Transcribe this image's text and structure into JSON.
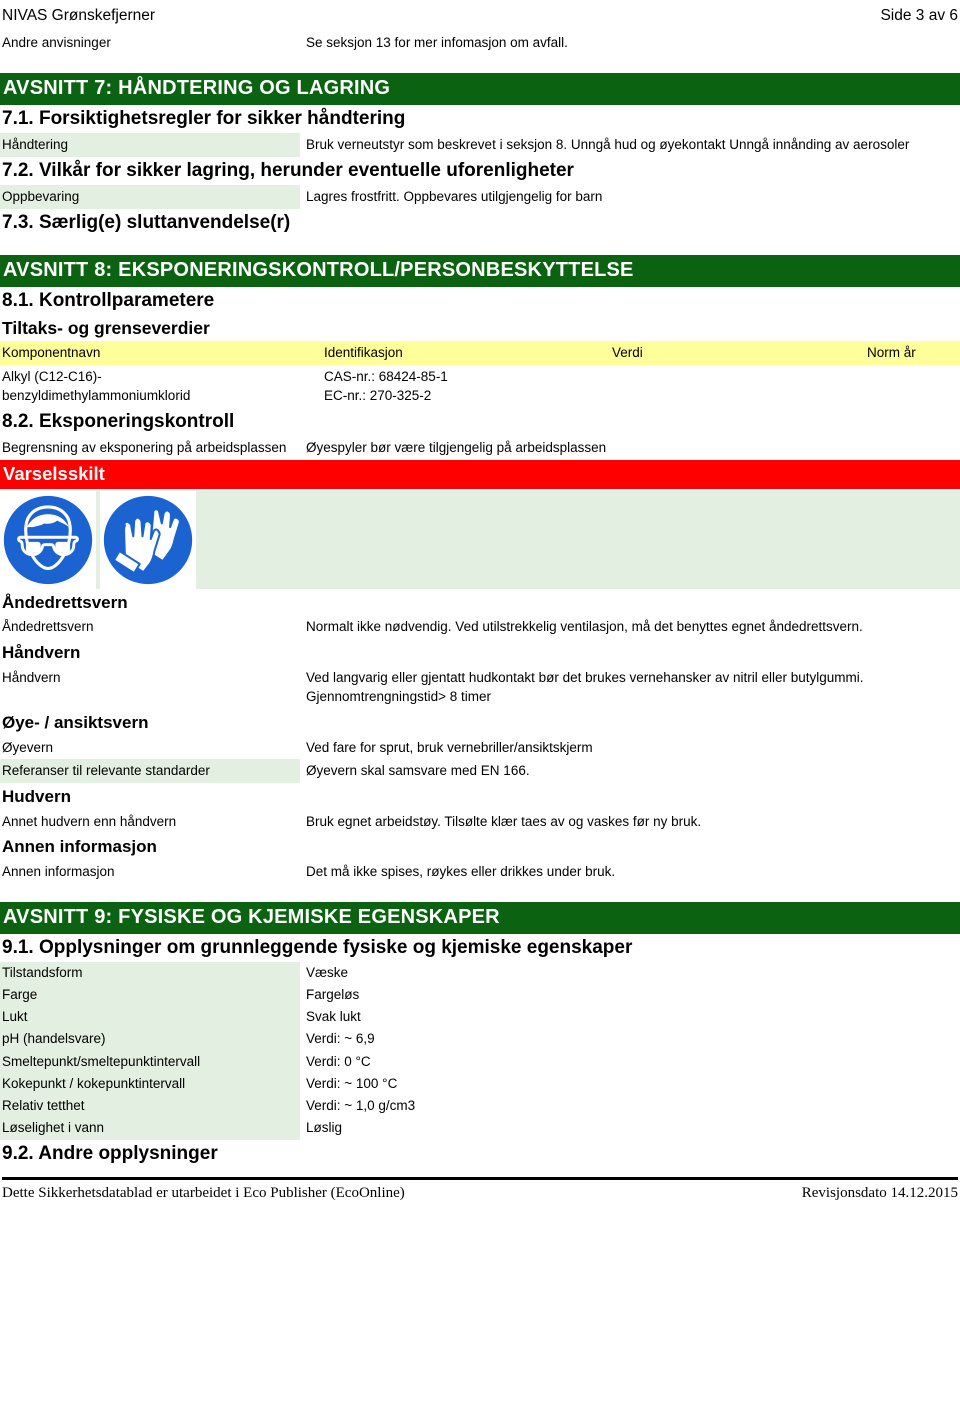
{
  "header": {
    "doc_title": "NIVAS Grønskefjerner",
    "page_label": "Side 3 av 6"
  },
  "top_row": {
    "label": "Andre anvisninger",
    "value": "Se seksjon 13 for mer infomasjon om avfall."
  },
  "section7": {
    "banner": "AVSNITT 7: HÅNDTERING OG LAGRING",
    "h71": "7.1. Forsiktighetsregler for sikker håndtering",
    "handtering_label": "Håndtering",
    "handtering_value": "Bruk verneutstyr som beskrevet i seksjon 8. Unngå hud og øyekontakt Unngå innånding av aerosoler",
    "h72": "7.2. Vilkår for sikker lagring, herunder eventuelle uforenligheter",
    "oppbevaring_label": "Oppbevaring",
    "oppbevaring_value": "Lagres frostfritt. Oppbevares utilgjengelig for barn",
    "h73": "7.3. Særlig(e) sluttanvendelse(r)"
  },
  "section8": {
    "banner": "AVSNITT 8: EKSPONERINGSKONTROLL/PERSONBESKYTTELSE",
    "h81": "8.1. Kontrollparametere",
    "limits_title": "Tiltaks- og grenseverdier",
    "limits_headers": [
      "Komponentnavn",
      "Identifikasjon",
      "Verdi",
      "Norm år"
    ],
    "limits_rows": [
      {
        "komponentnavn": "Alkyl (C12-C16)-benzyldimethylammoniumklorid",
        "komponentnavn_line1": "Alkyl (C12-C16)-",
        "komponentnavn_line2": "benzyldimethylammoniumklorid",
        "identifikasjon_line1": "CAS-nr.: 68424-85-1",
        "identifikasjon_line2": "EC-nr.: 270-325-2",
        "verdi": "",
        "norm_ar": ""
      }
    ],
    "h82": "8.2. Eksponeringskontroll",
    "begrensning_label": "Begrensning av eksponering på arbeidsplassen",
    "begrensning_value": "Øyespyler bør være tilgjengelig på arbeidsplassen",
    "varselsskilt": "Varselsskilt",
    "pictograms": [
      {
        "name": "eye-protection-pictogram",
        "alt": "Bruk vernebriller"
      },
      {
        "name": "hand-protection-pictogram",
        "alt": "Bruk vernehansker"
      }
    ],
    "protection_groups": [
      {
        "heading": "Åndedrettsvern",
        "label": "Åndedrettsvern",
        "value": "Normalt ikke nødvendig. Ved utilstrekkelig ventilasjon, må det benyttes egnet åndedrettsvern."
      },
      {
        "heading": "Håndvern",
        "label": "Håndvern",
        "value": "Ved langvarig eller gjentatt hudkontakt bør det brukes vernehansker av nitril eller butylgummi. Gjennomtrengningstid> 8 timer"
      },
      {
        "heading": "Øye- / ansiktsvern",
        "label": "Øyevern",
        "value": "Ved fare for sprut, bruk vernebriller/ansiktskjerm",
        "label2": "Referanser til relevante standarder",
        "value2": "Øyevern skal samsvare med EN 166."
      },
      {
        "heading": "Hudvern",
        "label": "Annet hudvern enn håndvern",
        "value": "Bruk egnet arbeidstøy. Tilsølte klær taes av og vaskes før ny bruk."
      },
      {
        "heading": "Annen informasjon",
        "label": "Annen informasjon",
        "value": "Det må ikke spises, røykes eller drikkes under bruk."
      }
    ]
  },
  "section9": {
    "banner": "AVSNITT 9: FYSISKE OG KJEMISKE EGENSKAPER",
    "h91": "9.1. Opplysninger om grunnleggende fysiske og kjemiske egenskaper",
    "properties": [
      {
        "label": "Tilstandsform",
        "value": "Væske"
      },
      {
        "label": "Farge",
        "value": "Fargeløs"
      },
      {
        "label": "Lukt",
        "value": "Svak lukt"
      },
      {
        "label": "pH (handelsvare)",
        "value": "Verdi: ~ 6,9"
      },
      {
        "label": "Smeltepunkt/smeltepunktintervall",
        "value": "Verdi: 0 °C"
      },
      {
        "label": "Kokepunkt / kokepunktintervall",
        "value": "Verdi: ~ 100 °C"
      },
      {
        "label": "Relativ tetthet",
        "value": "Verdi: ~ 1,0 g/cm3"
      },
      {
        "label": "Løselighet i vann",
        "value": "Løslig"
      }
    ],
    "h92": "9.2. Andre opplysninger"
  },
  "footer": {
    "left": "Dette Sikkerhetsdatablad er utarbeidet i Eco Publisher (EcoOnline)",
    "right": "Revisjonsdato 14.12.2015"
  },
  "colors": {
    "banner_green": "#0b6312",
    "banner_red": "#fe0000",
    "label_green": "#e3efe0",
    "table_header_yellow": "#ffff99",
    "pictogram_blue": "#1b63d0"
  }
}
